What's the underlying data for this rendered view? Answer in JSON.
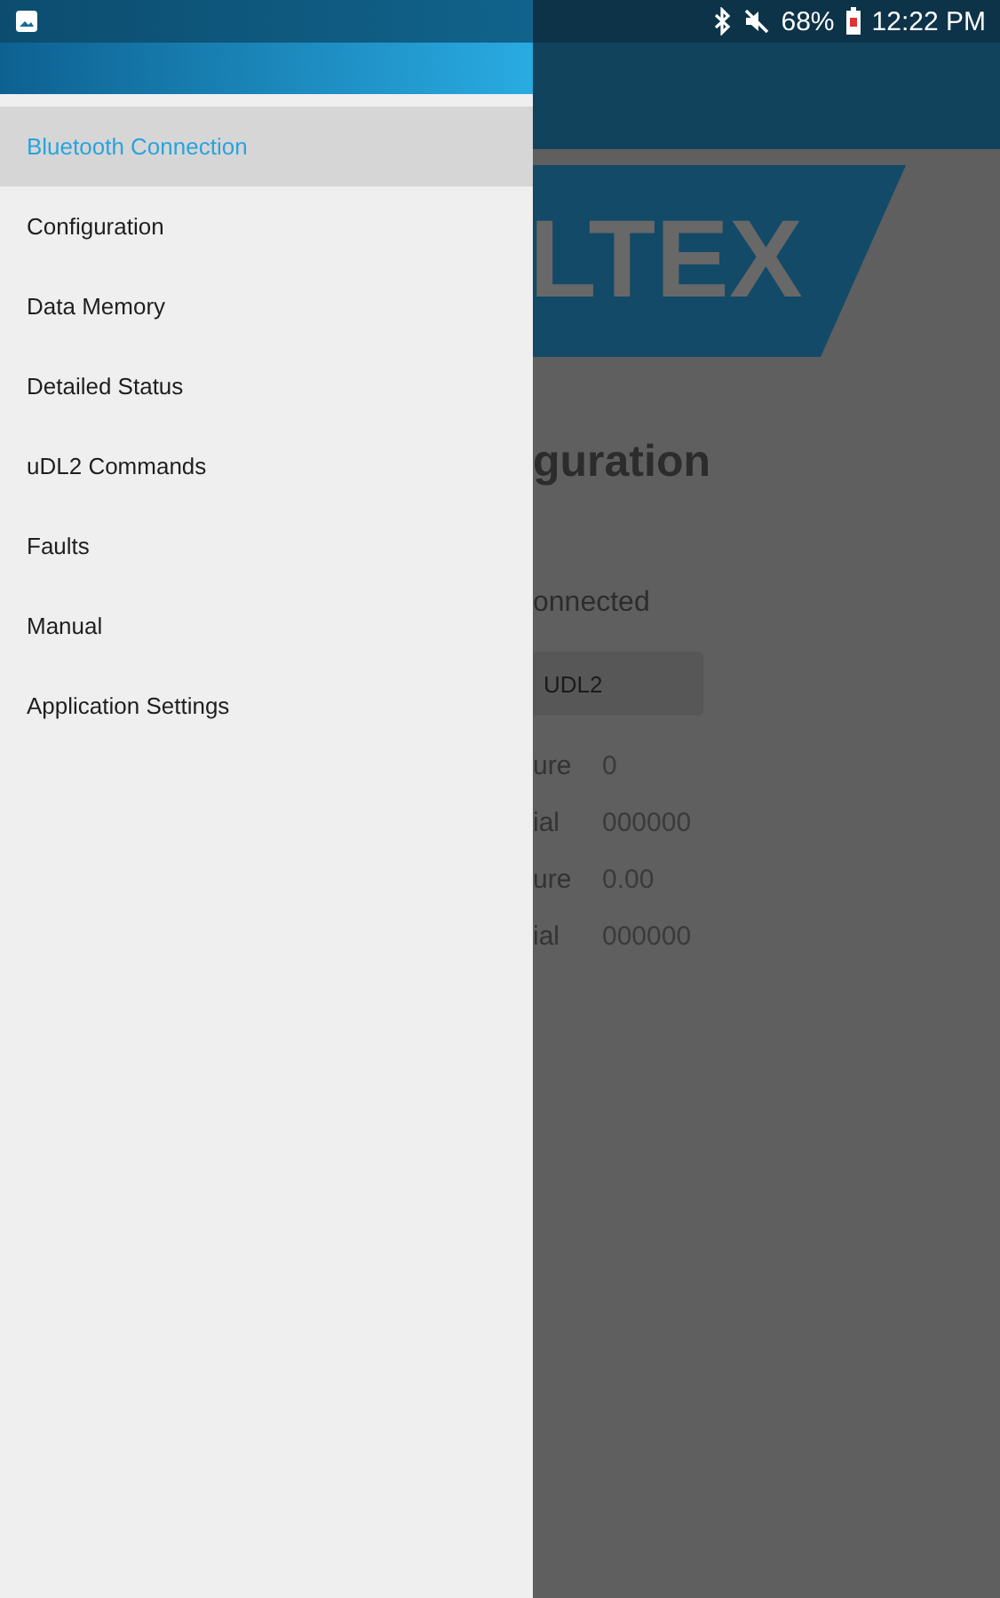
{
  "status_bar": {
    "battery": "68%",
    "time": "12:22 PM"
  },
  "drawer": {
    "items": [
      {
        "label": "Bluetooth Connection",
        "selected": true
      },
      {
        "label": "Configuration",
        "selected": false
      },
      {
        "label": "Data Memory",
        "selected": false
      },
      {
        "label": "Detailed Status",
        "selected": false
      },
      {
        "label": "uDL2 Commands",
        "selected": false
      },
      {
        "label": "Faults",
        "selected": false
      },
      {
        "label": "Manual",
        "selected": false
      },
      {
        "label": "Application Settings",
        "selected": false
      }
    ]
  },
  "background_screen": {
    "logo": "LTEX",
    "title": "guration",
    "status": "onnected",
    "button": "UDL2",
    "rows": [
      {
        "label": "ure",
        "value": "0"
      },
      {
        "label": "ial",
        "value": "000000"
      },
      {
        "label": "ure",
        "value": "0.00"
      },
      {
        "label": "ial",
        "value": "000000"
      }
    ]
  }
}
